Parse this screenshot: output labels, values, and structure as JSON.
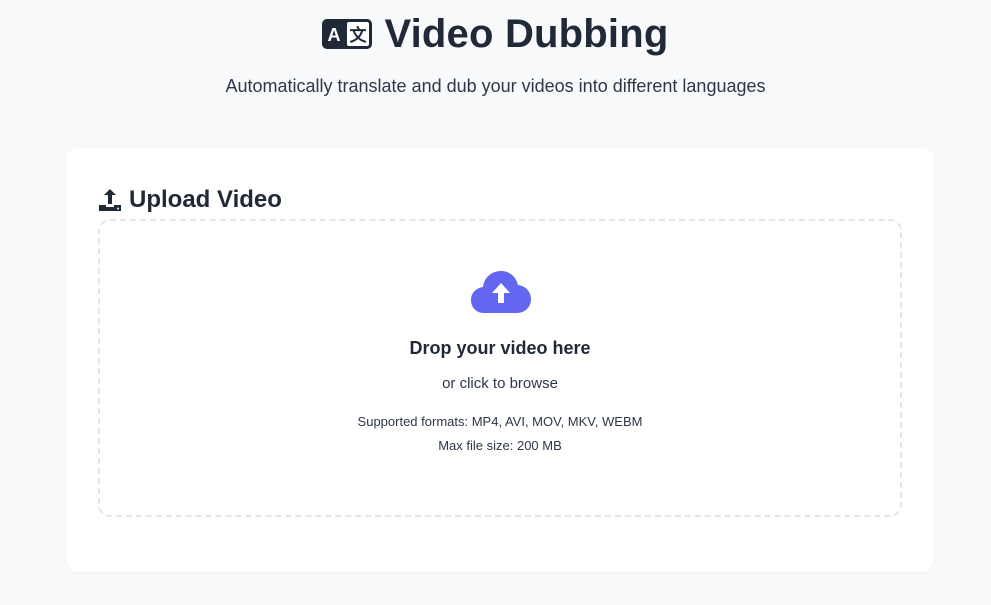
{
  "header": {
    "title": "Video Dubbing",
    "subtitle": "Automatically translate and dub your videos into different languages",
    "icon": "translate-icon"
  },
  "upload": {
    "section_title": "Upload Video",
    "section_icon": "upload-icon",
    "dropzone": {
      "icon": "cloud-upload-icon",
      "title": "Drop your video here",
      "subtitle": "or click to browse",
      "formats": "Supported formats: MP4, AVI, MOV, MKV, WEBM",
      "max_size": "Max file size: 200 MB"
    }
  },
  "colors": {
    "background": "#f8f9fb",
    "card": "#ffffff",
    "text": "#1f2937",
    "accent": "#6366f1",
    "dropzone_border": "#e2e5ea"
  }
}
